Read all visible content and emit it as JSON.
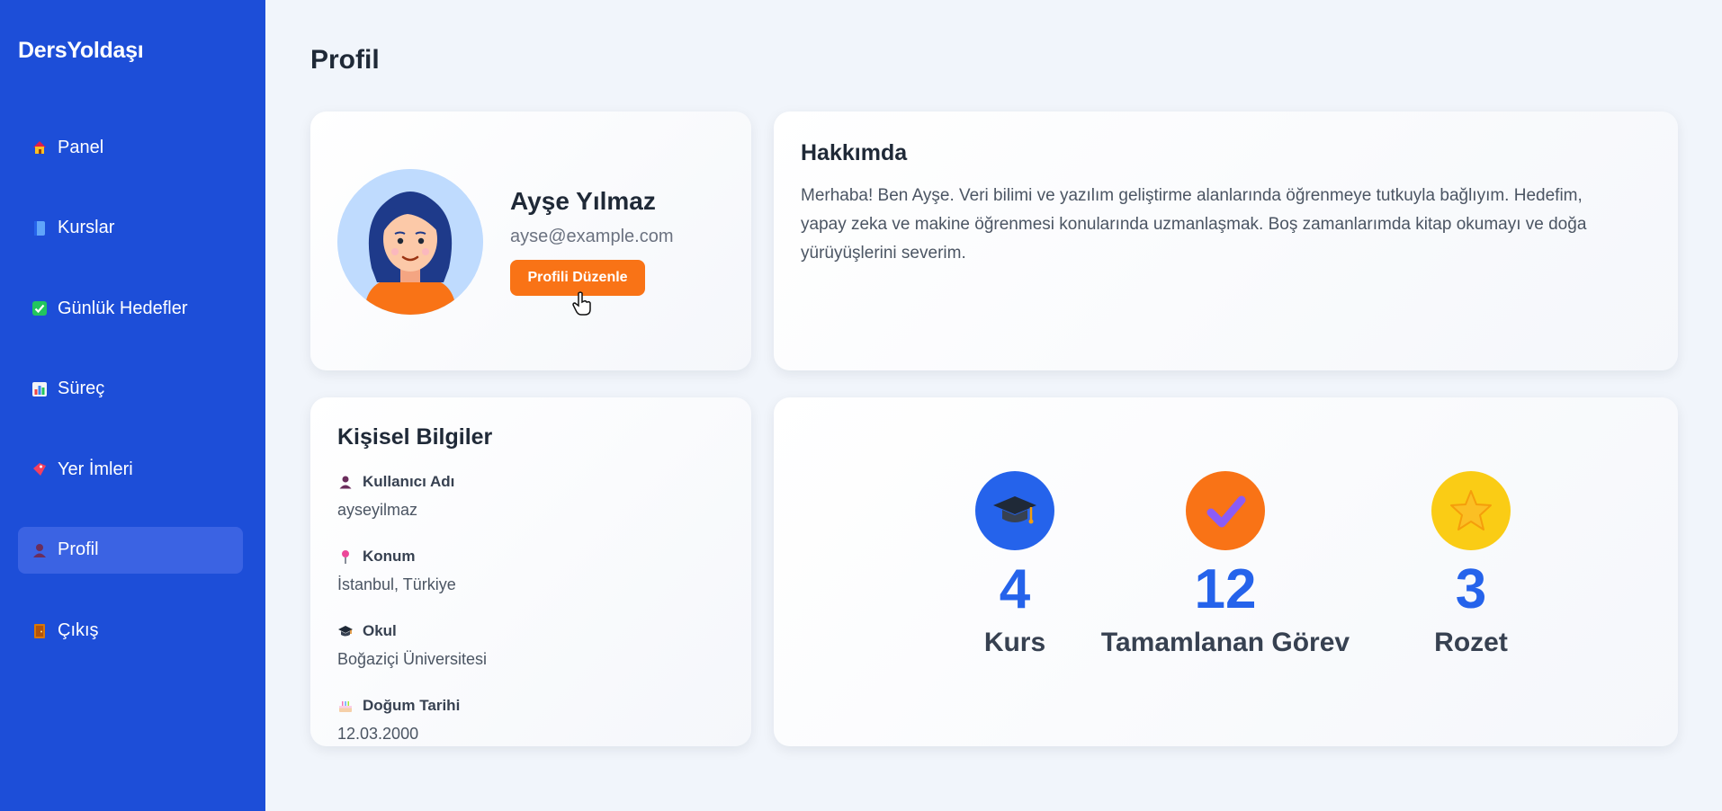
{
  "app": {
    "brand": "DersYoldaşı"
  },
  "sidebar": {
    "items": [
      {
        "label": "Panel",
        "icon": "house-icon"
      },
      {
        "label": "Kurslar",
        "icon": "blue-book-icon"
      },
      {
        "label": "Günlük Hedefler",
        "icon": "check-box-icon"
      },
      {
        "label": "Süreç",
        "icon": "bar-chart-icon"
      },
      {
        "label": "Yer İmleri",
        "icon": "bookmark-icon"
      },
      {
        "label": "Profil",
        "icon": "user-icon",
        "active": true
      },
      {
        "label": "Çıkış",
        "icon": "door-icon"
      }
    ]
  },
  "page": {
    "title": "Profil"
  },
  "profile": {
    "name": "Ayşe Yılmaz",
    "email": "ayse@example.com",
    "edit_button": "Profili Düzenle"
  },
  "about": {
    "title": "Hakkımda",
    "text": "Merhaba! Ben Ayşe. Veri bilimi ve yazılım geliştirme alanlarında öğrenmeye tutkuyla bağlıyım. Hedefim, yapay zeka ve makine öğrenmesi konularında uzmanlaşmak. Boş zamanlarımda kitap okumayı ve doğa yürüyüşlerini severim."
  },
  "personal": {
    "title": "Kişisel Bilgiler",
    "items": [
      {
        "label": "Kullanıcı Adı",
        "value": "ayseyilmaz",
        "icon": "user-icon"
      },
      {
        "label": "Konum",
        "value": "İstanbul, Türkiye",
        "icon": "pin-icon"
      },
      {
        "label": "Okul",
        "value": "Boğaziçi Üniversitesi",
        "icon": "graduation-cap-icon"
      },
      {
        "label": "Doğum Tarihi",
        "value": "12.03.2000",
        "icon": "birthday-cake-icon"
      }
    ]
  },
  "stats": [
    {
      "value": "4",
      "label": "Kurs",
      "icon": "graduation-cap-icon",
      "color": "#2563eb"
    },
    {
      "value": "12",
      "label": "Tamamlanan Görev",
      "icon": "checkmark-icon",
      "color": "#f97316"
    },
    {
      "value": "3",
      "label": "Rozet",
      "icon": "star-icon",
      "color": "#facc15"
    }
  ]
}
